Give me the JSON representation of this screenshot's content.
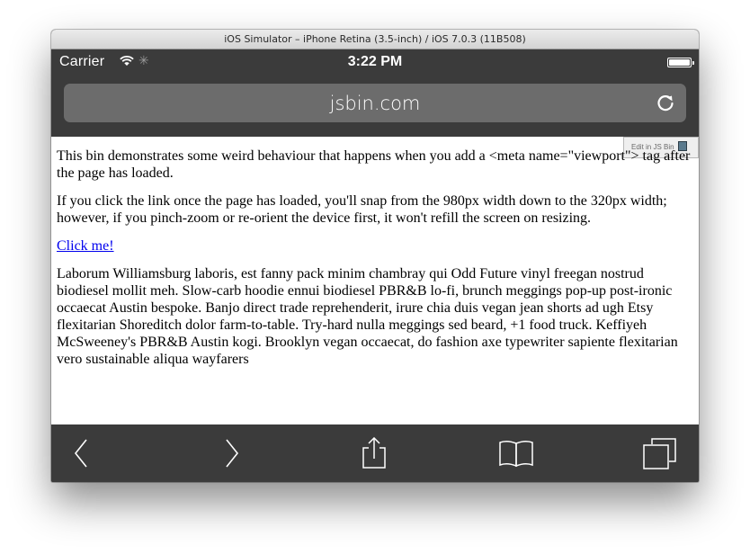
{
  "simulator": {
    "title": "iOS Simulator – iPhone Retina (3.5-inch) / iOS 7.0.3 (11B508)"
  },
  "status_bar": {
    "carrier": "Carrier",
    "time": "3:22 PM",
    "icons": [
      "wifi-icon",
      "activity-spinner-icon",
      "battery-icon"
    ]
  },
  "url_bar": {
    "domain": "jsbin.com",
    "reload_icon": "reload-icon"
  },
  "badge": {
    "label": "Edit in JS Bin"
  },
  "content": {
    "para1": "This bin demonstrates some weird behaviour that happens when you add a <meta name=\"viewport\"> tag after the page has loaded.",
    "para2": "If you click the link once the page has loaded, you'll snap from the 980px width down to the 320px width; however, if you pinch-zoom or re-orient the device first, it won't refill the screen on resizing.",
    "link": "Click me!",
    "para3": "Laborum Williamsburg laboris, est fanny pack minim chambray qui Odd Future vinyl freegan nostrud biodiesel mollit meh. Slow-carb hoodie ennui biodiesel PBR&B lo-fi, brunch meggings pop-up post-ironic occaecat Austin bespoke. Banjo direct trade reprehenderit, irure chia duis vegan jean shorts ad ugh Etsy flexitarian Shoreditch dolor farm-to-table. Try-hard nulla meggings sed beard, +1 food truck. Keffiyeh McSweeney's PBR&B Austin kogi. Brooklyn vegan occaecat, do fashion axe typewriter sapiente flexitarian vero sustainable aliqua wayfarers"
  },
  "toolbar": {
    "icons": [
      "back-icon",
      "forward-icon",
      "share-icon",
      "bookmarks-icon",
      "tabs-icon"
    ]
  },
  "colors": {
    "chrome_dark": "#3b3b3b",
    "url_field": "#6c6c6c",
    "link": "#0000ee"
  }
}
